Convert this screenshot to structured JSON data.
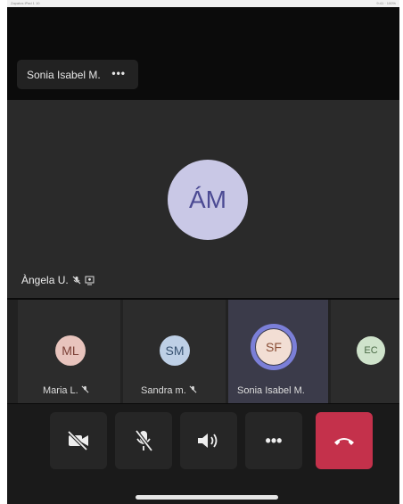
{
  "status": {
    "left": "Zapatos iPad 1 10",
    "right": "9:41 · 100%"
  },
  "pinned": {
    "name": "Sonia Isabel M.",
    "more": "•••"
  },
  "stage": {
    "initials": "ÁM",
    "speaker": "Àngela U."
  },
  "participants": [
    {
      "initials": "ML",
      "name": "Maria L.",
      "bg": "#e8c4bd",
      "fg": "#7a3f36"
    },
    {
      "initials": "SM",
      "name": "Sandra m.",
      "bg": "#bed0e6",
      "fg": "#365170"
    },
    {
      "initials": "SF",
      "name": "Sonia Isabel M.",
      "bg": "#f2ded4",
      "fg": "#8a4e36"
    },
    {
      "initials": "EC",
      "name": "",
      "bg": "#cfe3cb",
      "fg": "#4a6a45"
    }
  ],
  "controls": {
    "more": "•••"
  },
  "colors": {
    "end_call": "#c4314b",
    "speaking_ring": "#7b7fd8"
  }
}
